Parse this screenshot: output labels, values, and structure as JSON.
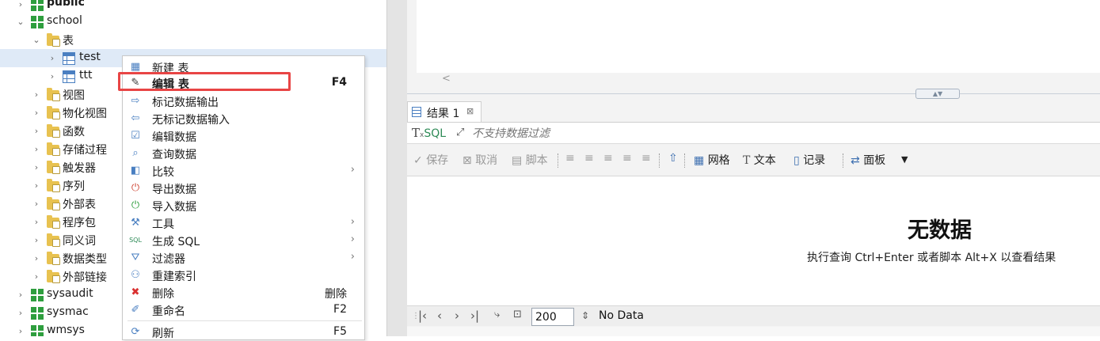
{
  "tree": {
    "items": [
      {
        "label": "public"
      },
      {
        "label": "school"
      },
      {
        "label": "表"
      },
      {
        "label": "test"
      },
      {
        "label": "ttt"
      },
      {
        "label": "视图"
      },
      {
        "label": "物化视图"
      },
      {
        "label": "函数"
      },
      {
        "label": "存储过程"
      },
      {
        "label": "触发器"
      },
      {
        "label": "序列"
      },
      {
        "label": "外部表"
      },
      {
        "label": "程序包"
      },
      {
        "label": "同义词"
      },
      {
        "label": "数据类型"
      },
      {
        "label": "外部链接"
      },
      {
        "label": "sysaudit"
      },
      {
        "label": "sysmac"
      },
      {
        "label": "wmsys"
      }
    ]
  },
  "context_menu": {
    "items": [
      {
        "label": "新建 表",
        "icon": "table-new-icon"
      },
      {
        "label": "编辑 表",
        "shortcut": "F4",
        "icon": "pencil-icon"
      },
      {
        "label": "标记数据输出",
        "icon": "export-marked-icon"
      },
      {
        "label": "无标记数据输入",
        "icon": "import-unmarked-icon"
      },
      {
        "label": "编辑数据",
        "icon": "edit-data-icon"
      },
      {
        "label": "查询数据",
        "icon": "query-data-icon"
      },
      {
        "label": "比较",
        "icon": "compare-icon"
      },
      {
        "label": "导出数据",
        "icon": "export-data-icon"
      },
      {
        "label": "导入数据",
        "icon": "import-data-icon"
      },
      {
        "label": "工具",
        "icon": "wrench-icon"
      },
      {
        "label": "生成 SQL",
        "icon": "sql-icon"
      },
      {
        "label": "过滤器",
        "icon": "filter-icon"
      },
      {
        "label": "重建索引",
        "icon": "rebuild-index-icon"
      },
      {
        "label": "删除",
        "shortcut": "删除",
        "icon": "delete-icon"
      },
      {
        "label": "重命名",
        "shortcut": "F2",
        "icon": "rename-icon"
      },
      {
        "label": "刷新",
        "shortcut": "F5",
        "icon": "refresh-icon"
      }
    ],
    "highlight_color": "#e84545"
  },
  "editor": {
    "scroll_left": "<"
  },
  "results": {
    "tab_label": "结果 1",
    "filter": {
      "sql_label": "SQL",
      "placeholder": "不支持数据过滤"
    },
    "toolbar": {
      "save": "保存",
      "cancel": "取消",
      "script": "脚本",
      "grid": "网格",
      "text": "文本",
      "record": "记录",
      "panel": "面板"
    },
    "empty": {
      "title": "无数据",
      "hint": "执行查询 Ctrl+Enter 或者脚本 Alt+X 以查看结果"
    },
    "pager": {
      "page_size": "200",
      "status": "No Data"
    }
  },
  "colors": {
    "schema_green": "#2e9e3e",
    "folder_yellow": "#e8c250",
    "selection": "#dfeaf7",
    "sql_green": "#2e8b57"
  }
}
